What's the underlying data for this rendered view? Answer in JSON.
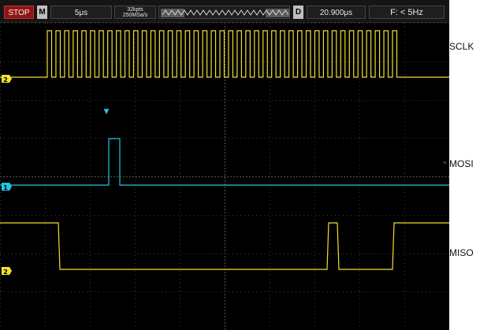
{
  "toolbar": {
    "stop_label": "STOP",
    "mode_label": "M",
    "timebase": "5μs",
    "memory_depth": "32kpts",
    "sample_rate": "250MSa/s",
    "delay_mode_label": "D",
    "trigger_delay": "20.900μs",
    "frequency": "F: < 5Hz"
  },
  "channels": [
    {
      "name": "SCLK",
      "marker": "2",
      "color": "#f0e030"
    },
    {
      "name": "MOSI",
      "marker": "1",
      "color": "#23c6e0"
    },
    {
      "name": "MISO",
      "marker": "2",
      "color": "#f0e030"
    }
  ],
  "trigger": {
    "marker": "▼",
    "color": "#23c6e0"
  }
}
